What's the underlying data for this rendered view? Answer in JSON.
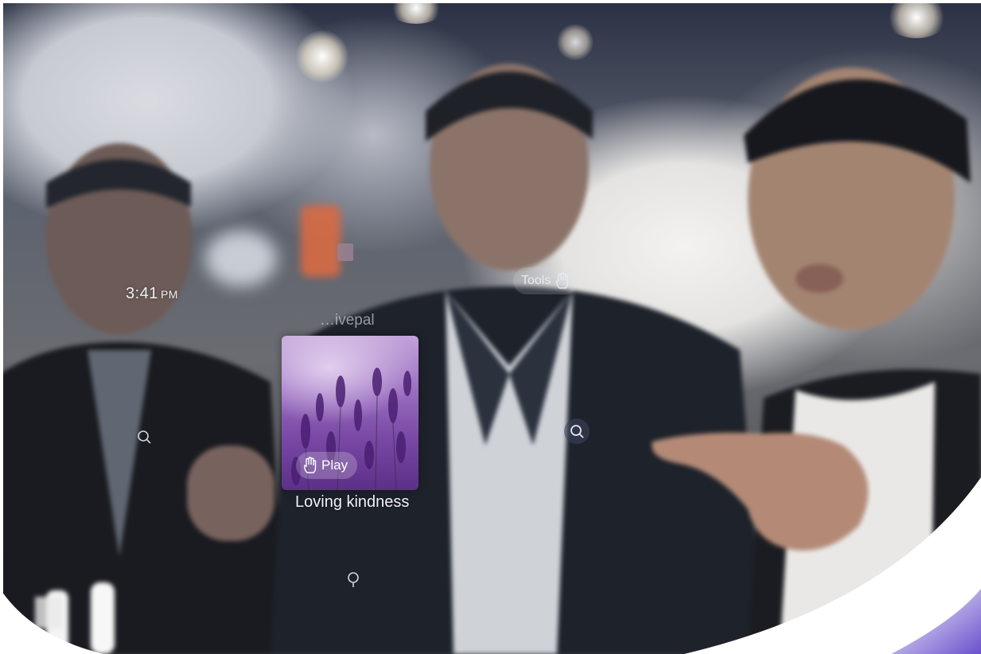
{
  "mirror_ui": {
    "clock": {
      "time": "3:41",
      "ampm": "PM"
    },
    "tools": {
      "label": "Tools",
      "icon": "gesture-hand-icon"
    },
    "app": {
      "name": "…ivepal"
    },
    "meditation_card": {
      "play_label": "Play",
      "play_icon": "gesture-hand-icon",
      "title": "Loving kindness",
      "accent": "#7a4aa6"
    },
    "gesture_hints": [
      "pointer-hint-icon",
      "pointer-hint-icon",
      "pointer-hint-icon"
    ]
  },
  "colors": {
    "ui_text": "#eef0f4",
    "pill_bg": "rgba(215,220,230,0.18)",
    "mirror_frame": "#ffffff",
    "frame_glow": "#6b4fd8"
  }
}
